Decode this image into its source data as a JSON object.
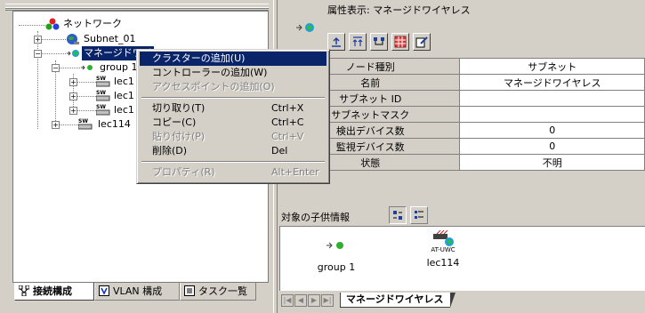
{
  "tree": {
    "root": "ネットワーク",
    "items": [
      {
        "label": "Subnet_01",
        "icon": "globe-icon"
      },
      {
        "label": "マネージドワイ",
        "icon": "wireless-network-icon"
      },
      {
        "label": "group 1",
        "icon": "wireless-group-icon"
      },
      {
        "label": "lec1",
        "icon": "switch-icon"
      },
      {
        "label": "lec1",
        "icon": "switch-icon"
      },
      {
        "label": "lec1",
        "icon": "switch-icon"
      },
      {
        "label": "lec114",
        "icon": "switch-icon"
      }
    ]
  },
  "context_menu": {
    "items": [
      {
        "label": "クラスターの追加(U)",
        "shortcut": "",
        "state": "highlighted"
      },
      {
        "label": "コントローラーの追加(W)",
        "shortcut": "",
        "state": "enabled"
      },
      {
        "label": "アクセスポイントの追加(O)",
        "shortcut": "",
        "state": "disabled"
      },
      {
        "label": "切り取り(T)",
        "shortcut": "Ctrl+X",
        "state": "enabled"
      },
      {
        "label": "コピー(C)",
        "shortcut": "Ctrl+C",
        "state": "enabled"
      },
      {
        "label": "貼り付け(P)",
        "shortcut": "Ctrl+V",
        "state": "disabled"
      },
      {
        "label": "削除(D)",
        "shortcut": "Del",
        "state": "enabled"
      },
      {
        "label": "プロパティ(R)",
        "shortcut": "Alt+Enter",
        "state": "disabled"
      }
    ]
  },
  "tabs": [
    {
      "label": "接続構成",
      "icon": "topology-icon",
      "active": true
    },
    {
      "label": "VLAN 構成",
      "icon": "vlan-icon",
      "active": false
    },
    {
      "label": "タスク一覧",
      "icon": "task-list-icon",
      "active": false
    }
  ],
  "properties": {
    "title": "属性表示: マネージドワイヤレス",
    "rows": [
      {
        "key": "ノード種別",
        "value": "サブネット"
      },
      {
        "key": "名前",
        "value": "マネージドワイヤレス"
      },
      {
        "key": "サブネット ID",
        "value": ""
      },
      {
        "key": "サブネットマスク",
        "value": ""
      },
      {
        "key": "検出デバイス数",
        "value": "0"
      },
      {
        "key": "監視デバイス数",
        "value": "0"
      },
      {
        "key": "状態",
        "value": "不明"
      }
    ]
  },
  "children": {
    "label": "対象の子供情報",
    "items": [
      {
        "label": "group 1",
        "icon": "wireless-group-icon"
      },
      {
        "label": "lec114",
        "icon": "at-uwc-controller-icon",
        "sublabel": "AT-UWC"
      }
    ]
  },
  "sheet_tab": {
    "label": "マネージドワイヤレス"
  },
  "colors": {
    "selection": "#0a246a",
    "face": "#d4d0c8"
  }
}
